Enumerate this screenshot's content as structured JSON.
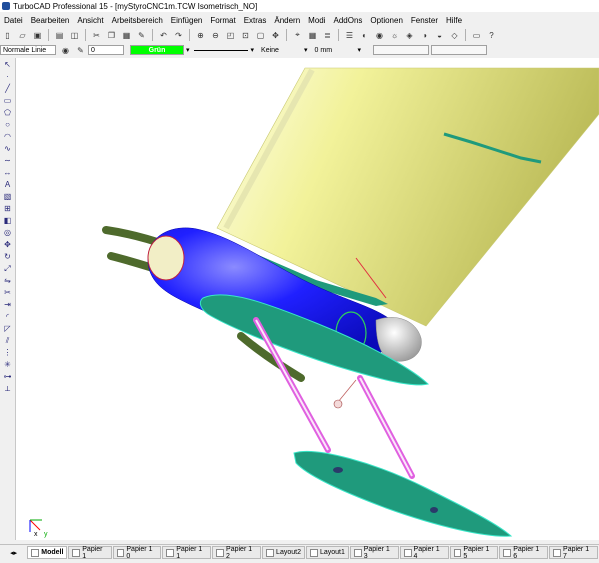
{
  "window": {
    "title": "TurboCAD Professional 15 - [myStyroCNC1m.TCW Isometrisch_NO]"
  },
  "menu": [
    "Datei",
    "Bearbeiten",
    "Ansicht",
    "Arbeitsbereich",
    "Einfügen",
    "Format",
    "Extras",
    "Ändern",
    "Modi",
    "AddOns",
    "Optionen",
    "Fenster",
    "Hilfe"
  ],
  "props": {
    "linestyle": "Normale Linie",
    "layer_value": "0",
    "color": "Grün",
    "pattern": "Keine",
    "width": "0 mm"
  },
  "tabs": [
    "Modell",
    "Papier 1",
    "Papier 1 0",
    "Papier 1 1",
    "Papier 1 2",
    "Layout2",
    "Layout1",
    "Papier 1 3",
    "Papier 1 4",
    "Papier 1 5",
    "Papier 1 6",
    "Papier 1 7"
  ],
  "icons": {
    "toolbar1": [
      "new-icon",
      "open-icon",
      "save-icon",
      "print-icon",
      "preview-icon",
      "cut-icon",
      "copy-icon",
      "paste-icon",
      "format-painter-icon",
      "undo-icon",
      "redo-icon",
      "zoom-in-icon",
      "zoom-out-icon",
      "zoom-window-icon",
      "zoom-all-icon",
      "zoom-extents-icon",
      "pan-icon",
      "snap-icon",
      "grid-icon",
      "layers-icon",
      "properties-icon",
      "render-icon",
      "camera-icon",
      "light-icon",
      "material-icon",
      "hide-icon",
      "shade-icon",
      "wireframe-icon",
      "view-icon",
      "help-icon"
    ],
    "lefttools": [
      "select-icon",
      "point-icon",
      "line-icon",
      "rectangle-icon",
      "polygon-icon",
      "circle-icon",
      "arc-icon",
      "curve-icon",
      "spline-icon",
      "dimension-icon",
      "text-icon",
      "hatch-icon",
      "insert-icon",
      "block-icon",
      "symbol-icon",
      "move-icon",
      "rotate-icon",
      "scale-icon",
      "mirror-icon",
      "trim-icon",
      "extend-icon",
      "fillet-icon",
      "chamfer-icon",
      "offset-icon",
      "array-icon",
      "explode-icon",
      "join-icon",
      "measure-icon"
    ]
  },
  "colors": {
    "wing": "#e8e87a",
    "fuselage": "#1a1aff",
    "teal": "#1f9a7c",
    "strut": "#e060e0"
  }
}
